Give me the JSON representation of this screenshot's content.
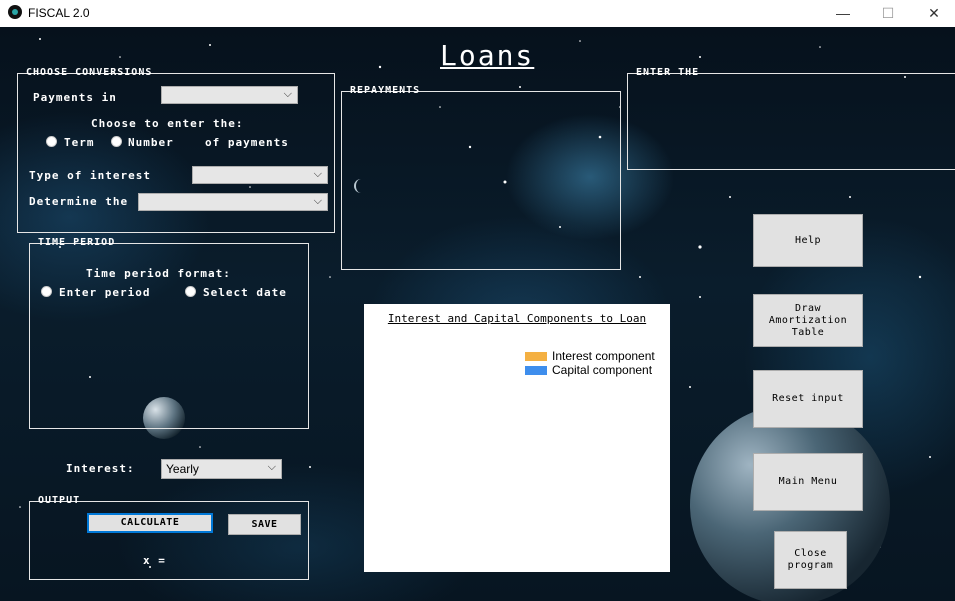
{
  "window": {
    "title": "FISCAL 2.0",
    "controls": {
      "minimize": "—",
      "maximize": "☐",
      "close": "✕"
    }
  },
  "page": {
    "title": "Loans"
  },
  "choose_conversions": {
    "label": "CHOOSE CONVERSIONS",
    "payments_in_label": "Payments in",
    "payments_in_value": "",
    "choose_to_enter": "Choose to enter the:",
    "option_term": "Term",
    "option_number": "Number",
    "of_payments": "of payments",
    "type_of_interest_label": "Type of interest",
    "type_of_interest_value": "",
    "determine_label": "Determine the",
    "determine_value": ""
  },
  "repayments": {
    "label": "REPAYMENTS"
  },
  "enter_the": {
    "label": "ENTER THE"
  },
  "time_period": {
    "label": "TIME PERIOD",
    "format_label": "Time period format:",
    "option_enter": "Enter period",
    "option_select": "Select date"
  },
  "interest": {
    "label": "Interest:",
    "value": "Yearly"
  },
  "output": {
    "label": "OUTPUT",
    "calculate": "CALCULATE",
    "save": "SAVE",
    "result": "x ="
  },
  "chart_data": {
    "type": "bar",
    "title": "Interest and Capital Components to Loan",
    "categories": [],
    "series": [
      {
        "name": "Interest component",
        "color": "#f4b042",
        "values": []
      },
      {
        "name": "Capital component",
        "color": "#3e8eed",
        "values": []
      }
    ]
  },
  "buttons": {
    "help": "Help",
    "draw": "Draw Amortization Table",
    "reset": "Reset input",
    "main_menu": "Main Menu",
    "close": "Close program"
  },
  "icons": {
    "chevron": "chevron-down-icon"
  }
}
